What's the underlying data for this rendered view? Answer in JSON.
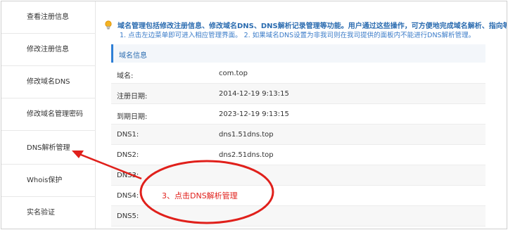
{
  "sidebar": {
    "items": [
      {
        "label": "查看注册信息"
      },
      {
        "label": "修改注册信息"
      },
      {
        "label": "修改域名DNS"
      },
      {
        "label": "修改域名管理密码"
      },
      {
        "label": "DNS解析管理"
      },
      {
        "label": "Whois保护"
      },
      {
        "label": "实名验证"
      }
    ]
  },
  "notice": {
    "line1": "域名管理包括修改注册信息、修改域名DNS、DNS解析记录管理等功能。用户通过这些操作，可方便地完成域名解析、指向等工作。",
    "line2": "1. 点击左边菜单即可进入相应管理界面。 2. 如果域名DNS设置为非我司则在我司提供的面板内不能进行DNS解析管理。"
  },
  "panel": {
    "title": "域名信息",
    "rows": [
      {
        "label": "域名:",
        "value": "com.top"
      },
      {
        "label": "注册日期:",
        "value": "2014-12-19 9:13:15"
      },
      {
        "label": "到期日期:",
        "value": "2023-12-19 9:13:15"
      },
      {
        "label": "DNS1:",
        "value": "dns1.51dns.top"
      },
      {
        "label": "DNS2:",
        "value": "dns2.51dns.top"
      },
      {
        "label": "DNS3:",
        "value": ""
      },
      {
        "label": "DNS4:",
        "value": ""
      },
      {
        "label": "DNS5:",
        "value": ""
      }
    ]
  },
  "annotation": {
    "text": "3、点击DNS解析管理",
    "color": "#e0201b"
  },
  "colors": {
    "accent": "#2e7fd6",
    "notice_text": "#2b6cb0"
  },
  "icons": {
    "notice": "lightbulb-icon"
  }
}
